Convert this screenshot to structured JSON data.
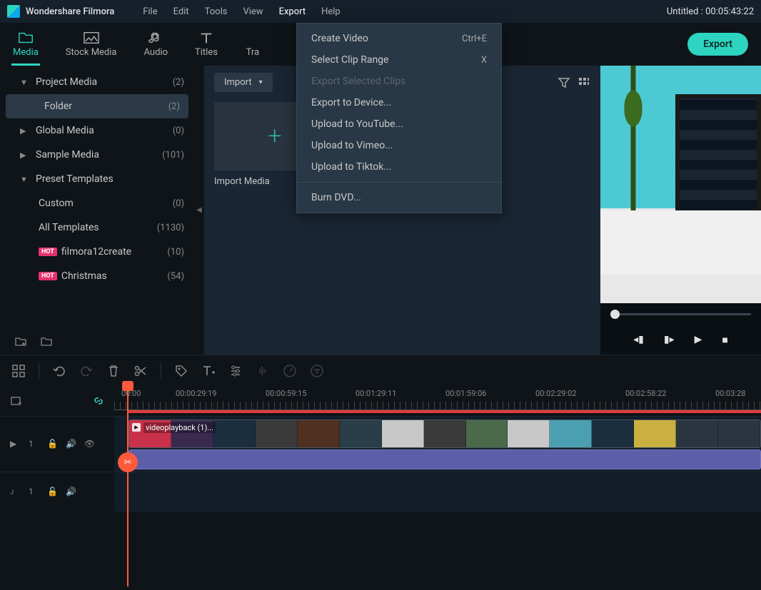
{
  "app": {
    "name": "Wondershare Filmora",
    "title": "Untitled : 00:05:43:22"
  },
  "menu": {
    "file": "File",
    "edit": "Edit",
    "tools": "Tools",
    "view": "View",
    "export": "Export",
    "help": "Help"
  },
  "tabs": {
    "media": "Media",
    "stock": "Stock Media",
    "audio": "Audio",
    "titles": "Titles",
    "transitions": "Tra"
  },
  "export_btn": "Export",
  "export_menu": {
    "create_video": {
      "label": "Create Video",
      "shortcut": "Ctrl+E"
    },
    "select_clip_range": {
      "label": "Select Clip Range",
      "shortcut": "X"
    },
    "export_selected": "Export Selected Clips",
    "export_device": "Export to Device...",
    "upload_youtube": "Upload to YouTube...",
    "upload_vimeo": "Upload to Vimeo...",
    "upload_tiktok": "Upload to Tiktok...",
    "burn_dvd": "Burn DVD..."
  },
  "sidebar": {
    "project_media": {
      "label": "Project Media",
      "count": "(2)"
    },
    "folder": {
      "label": "Folder",
      "count": "(2)"
    },
    "global_media": {
      "label": "Global Media",
      "count": "(0)"
    },
    "sample_media": {
      "label": "Sample Media",
      "count": "(101)"
    },
    "preset_templates": {
      "label": "Preset Templates"
    },
    "custom": {
      "label": "Custom",
      "count": "(0)"
    },
    "all_templates": {
      "label": "All Templates",
      "count": "(1130)"
    },
    "filmora12create": {
      "label": "filmora12create",
      "count": "(10)",
      "hot": "HOT"
    },
    "christmas": {
      "label": "Christmas",
      "count": "(54)",
      "hot": "HOT"
    }
  },
  "media": {
    "import_btn": "Import",
    "import_tile": "Import Media",
    "item1": "videoplayback (1)"
  },
  "timeline": {
    "ruler": [
      "00:00",
      "00:00:29:19",
      "00:00:59:15",
      "00:01:29:11",
      "00:01:59:06",
      "00:02:29:02",
      "00:02:58:22",
      "00:03:28"
    ],
    "clip_label": "videoplayback (1)...",
    "video_track": "1",
    "audio_track": "1"
  }
}
